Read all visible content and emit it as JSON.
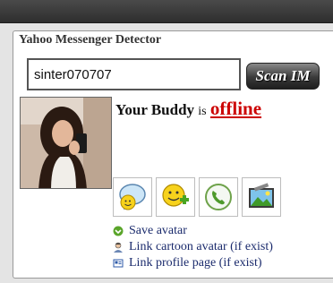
{
  "app": {
    "title": "Yahoo Messenger Detector"
  },
  "search": {
    "value": "sinter070707",
    "button_label": "Scan IM"
  },
  "status": {
    "prefix": "Your Buddy",
    "connector": "is",
    "state": "offline",
    "state_color": "#cc0000"
  },
  "actions": [
    {
      "name": "chat-icon"
    },
    {
      "name": "add-buddy-icon"
    },
    {
      "name": "call-icon"
    },
    {
      "name": "photo-icon"
    }
  ],
  "links": [
    {
      "label": "Save avatar",
      "icon": "save-arrow-icon"
    },
    {
      "label": "Link cartoon avatar (if exist)",
      "icon": "cartoon-avatar-icon"
    },
    {
      "label": "Link profile page (if exist)",
      "icon": "profile-card-icon"
    }
  ]
}
